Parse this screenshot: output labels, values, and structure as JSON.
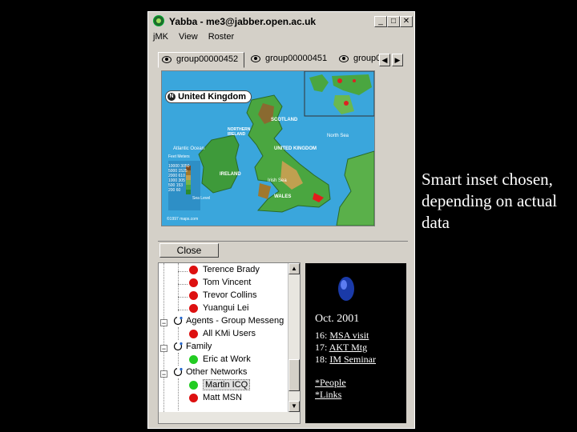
{
  "window": {
    "title": "Yabba - me3@jabber.open.ac.uk",
    "minimize": "_",
    "maximize": "□",
    "close": "✕"
  },
  "menu": [
    "jMK",
    "View",
    "Roster"
  ],
  "tabs": [
    "group00000452",
    "group00000451",
    "group0"
  ],
  "tab_nav": {
    "left": "◀",
    "right": "▶"
  },
  "map": {
    "country_label": "United Kingdom",
    "sea_labels": {
      "atlantic": "Atlantic Ocean",
      "north_sea": "North Sea",
      "irish_sea": "Irish Sea"
    },
    "regions": [
      "SCOTLAND",
      "NORTHERN IRELAND",
      "IRELAND",
      "WALES",
      "UNITED KINGDOM"
    ],
    "legend_title": "Feet   Meters",
    "legend_rows": [
      "10000  3050",
      "5000  1525",
      "2000  610",
      "1000  305",
      "500  153",
      "200  60"
    ],
    "sea_level": "Sea Level",
    "copyright": "©1997 maps.com"
  },
  "close_label": "Close",
  "roster": {
    "items": [
      {
        "label": "Terence Brady",
        "status": "red",
        "kind": "contact"
      },
      {
        "label": "Tom Vincent",
        "status": "red",
        "kind": "contact"
      },
      {
        "label": "Trevor Collins",
        "status": "red",
        "kind": "contact"
      },
      {
        "label": "Yuangui Lei",
        "status": "red",
        "kind": "contact"
      },
      {
        "label": "Agents - Group Messeng",
        "kind": "group"
      },
      {
        "label": "All KMi Users",
        "status": "red",
        "kind": "contact"
      },
      {
        "label": "Family",
        "kind": "group"
      },
      {
        "label": "Eric at Work",
        "status": "green",
        "kind": "contact"
      },
      {
        "label": "Other Networks",
        "kind": "group"
      },
      {
        "label": "Martin ICQ",
        "status": "green",
        "kind": "contact"
      },
      {
        "label": "Matt MSN",
        "status": "red",
        "kind": "contact"
      }
    ],
    "scroll_up": "▲",
    "scroll_down": "▼"
  },
  "info": {
    "date": "Oct. 2001",
    "events": [
      {
        "day": "16:",
        "text": "MSA visit"
      },
      {
        "day": "17:",
        "text": "AKT Mtg"
      },
      {
        "day": "18:",
        "text": "IM Seminar"
      }
    ],
    "links": [
      "*People",
      "*Links"
    ]
  },
  "caption": "Smart inset chosen, depending on actual data"
}
